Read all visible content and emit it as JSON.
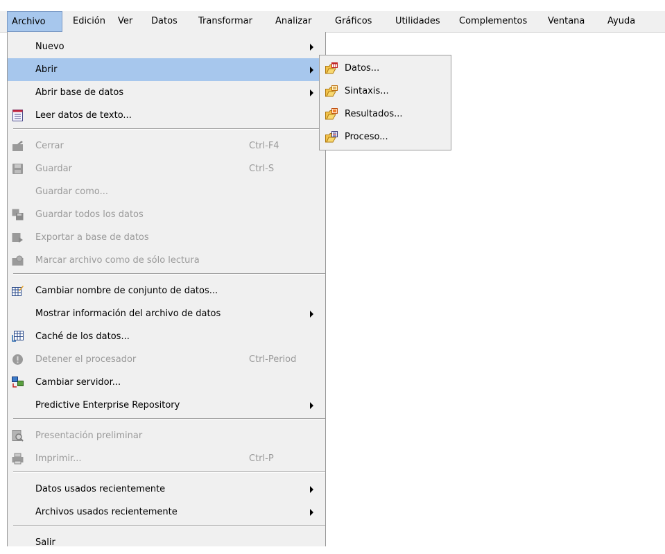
{
  "menubar": {
    "items": [
      {
        "label": "Archivo",
        "active": true
      },
      {
        "label": "Edición"
      },
      {
        "label": "Ver"
      },
      {
        "label": "Datos"
      },
      {
        "label": "Transformar"
      },
      {
        "label": "Analizar"
      },
      {
        "label": "Gráficos"
      },
      {
        "label": "Utilidades"
      },
      {
        "label": "Complementos"
      },
      {
        "label": "Ventana"
      },
      {
        "label": "Ayuda"
      }
    ]
  },
  "file_menu": {
    "items": [
      {
        "label": "Nuevo",
        "submenu": true
      },
      {
        "label": "Abrir",
        "submenu": true,
        "highlighted": true
      },
      {
        "label": "Abrir base de datos",
        "submenu": true
      },
      {
        "label": "Leer datos de texto...",
        "icon": "text-data-icon"
      },
      {
        "label": "Cerrar",
        "shortcut": "Ctrl-F4",
        "disabled": true,
        "icon": "close-window-icon"
      },
      {
        "label": "Guardar",
        "shortcut": "Ctrl-S",
        "disabled": true,
        "icon": "save-icon"
      },
      {
        "label": "Guardar como...",
        "disabled": true
      },
      {
        "label": "Guardar todos los datos",
        "disabled": true,
        "icon": "save-all-icon"
      },
      {
        "label": "Exportar a base de datos",
        "disabled": true,
        "icon": "export-database-icon"
      },
      {
        "label": "Marcar archivo como de sólo lectura",
        "disabled": true,
        "icon": "read-only-icon"
      },
      {
        "label": "Cambiar nombre de conjunto de datos...",
        "icon": "rename-dataset-icon"
      },
      {
        "label": "Mostrar información del archivo de datos",
        "submenu": true
      },
      {
        "label": "Caché de los datos...",
        "icon": "cache-data-icon"
      },
      {
        "label": "Detener el procesador",
        "shortcut": "Ctrl-Period",
        "disabled": true,
        "icon": "stop-processor-icon"
      },
      {
        "label": "Cambiar servidor...",
        "icon": "change-server-icon"
      },
      {
        "label": "Predictive Enterprise Repository",
        "submenu": true
      },
      {
        "label": "Presentación preliminar",
        "disabled": true,
        "icon": "print-preview-icon"
      },
      {
        "label": "Imprimir...",
        "shortcut": "Ctrl-P",
        "disabled": true,
        "icon": "print-icon"
      },
      {
        "label": "Datos usados recientemente",
        "submenu": true
      },
      {
        "label": "Archivos usados recientemente",
        "submenu": true
      },
      {
        "label": "Salir"
      }
    ]
  },
  "open_submenu": {
    "items": [
      {
        "label": "Datos...",
        "icon": "open-data-icon"
      },
      {
        "label": "Sintaxis...",
        "icon": "open-syntax-icon"
      },
      {
        "label": "Resultados...",
        "icon": "open-output-icon"
      },
      {
        "label": "Proceso...",
        "icon": "open-script-icon"
      }
    ]
  },
  "colors": {
    "menu_bg": "#f0f0f0",
    "highlight": "#a7c7ed",
    "disabled_text": "#9a9a9a"
  }
}
